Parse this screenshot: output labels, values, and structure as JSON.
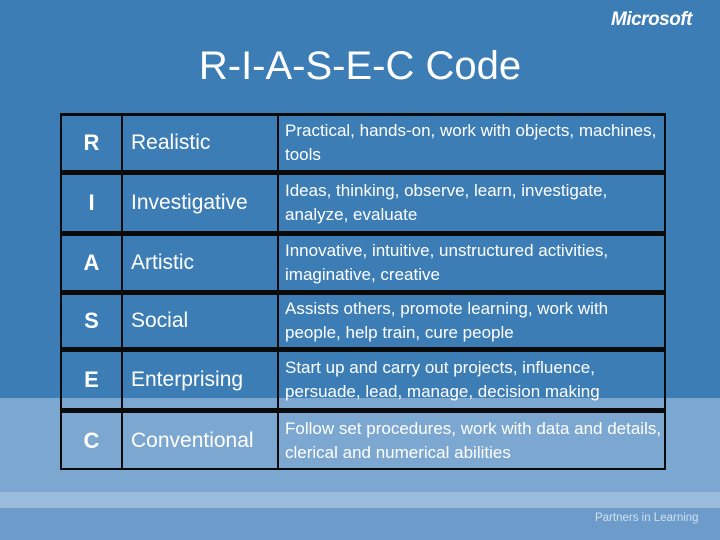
{
  "brand": {
    "logo_text": "Microsoft",
    "footer_text": "Partners in Learning"
  },
  "slide": {
    "title": "R-I-A-S-E-C  Code"
  },
  "rows": [
    {
      "letter": "R",
      "type": "Realistic",
      "description": "Practical, hands-on, work with objects, machines, tools"
    },
    {
      "letter": "I",
      "type": "Investigative",
      "description": "Ideas, thinking, observe, learn, investigate, analyze, evaluate"
    },
    {
      "letter": "A",
      "type": "Artistic",
      "description": "Innovative, intuitive, unstructured activities, imaginative, creative"
    },
    {
      "letter": "S",
      "type": "Social",
      "description": "Assists others, promote learning, work with people, help train, cure people"
    },
    {
      "letter": "E",
      "type": "Enterprising",
      "description": "Start up and carry out projects, influence, persuade, lead, manage, decision making"
    },
    {
      "letter": "C",
      "type": "Conventional",
      "description": "Follow set procedures, work with data and details, clerical and numerical abilities"
    }
  ]
}
